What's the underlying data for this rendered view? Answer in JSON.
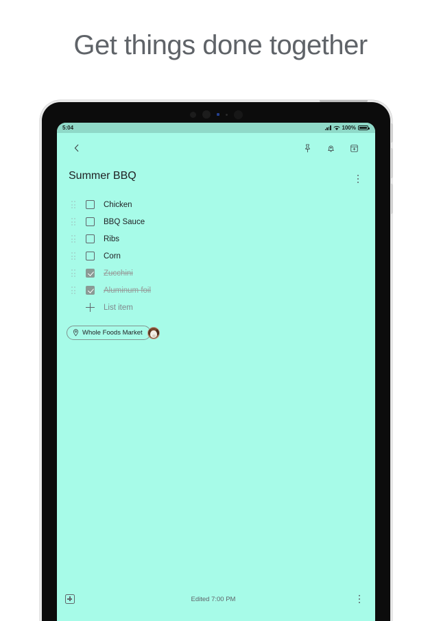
{
  "headline": "Get things done together",
  "status_bar": {
    "time": "5:04",
    "battery_percent": "100%",
    "signal_icon": "signal-bars-icon",
    "wifi_icon": "wifi-icon",
    "battery_icon": "battery-icon"
  },
  "toolbar": {
    "back_icon": "back-chevron-icon",
    "pin_icon": "pin-icon",
    "reminder_icon": "bell-add-icon",
    "archive_icon": "archive-add-icon"
  },
  "note": {
    "title": "Summer BBQ",
    "menu_icon": "overflow-menu-icon",
    "items": [
      {
        "label": "Chicken",
        "checked": false
      },
      {
        "label": "BBQ Sauce",
        "checked": false
      },
      {
        "label": "Ribs",
        "checked": false
      },
      {
        "label": "Corn",
        "checked": false
      },
      {
        "label": "Zucchini",
        "checked": true
      },
      {
        "label": "Aluminum foil",
        "checked": true
      }
    ],
    "add_item_label": "List item",
    "add_item_icon": "plus-icon",
    "location_chip": {
      "label": "Whole Foods Market",
      "icon": "location-pin-icon"
    },
    "collaborator_avatar": "dog-avatar"
  },
  "bottom_bar": {
    "add_icon": "add-box-icon",
    "edited_text": "Edited 7:00 PM",
    "menu_icon": "overflow-menu-icon"
  },
  "colors": {
    "note_background": "#a7fbe8",
    "page_background": "#ffffff",
    "headline_text": "#5f6368",
    "status_bar_background": "#8fd9c8"
  }
}
